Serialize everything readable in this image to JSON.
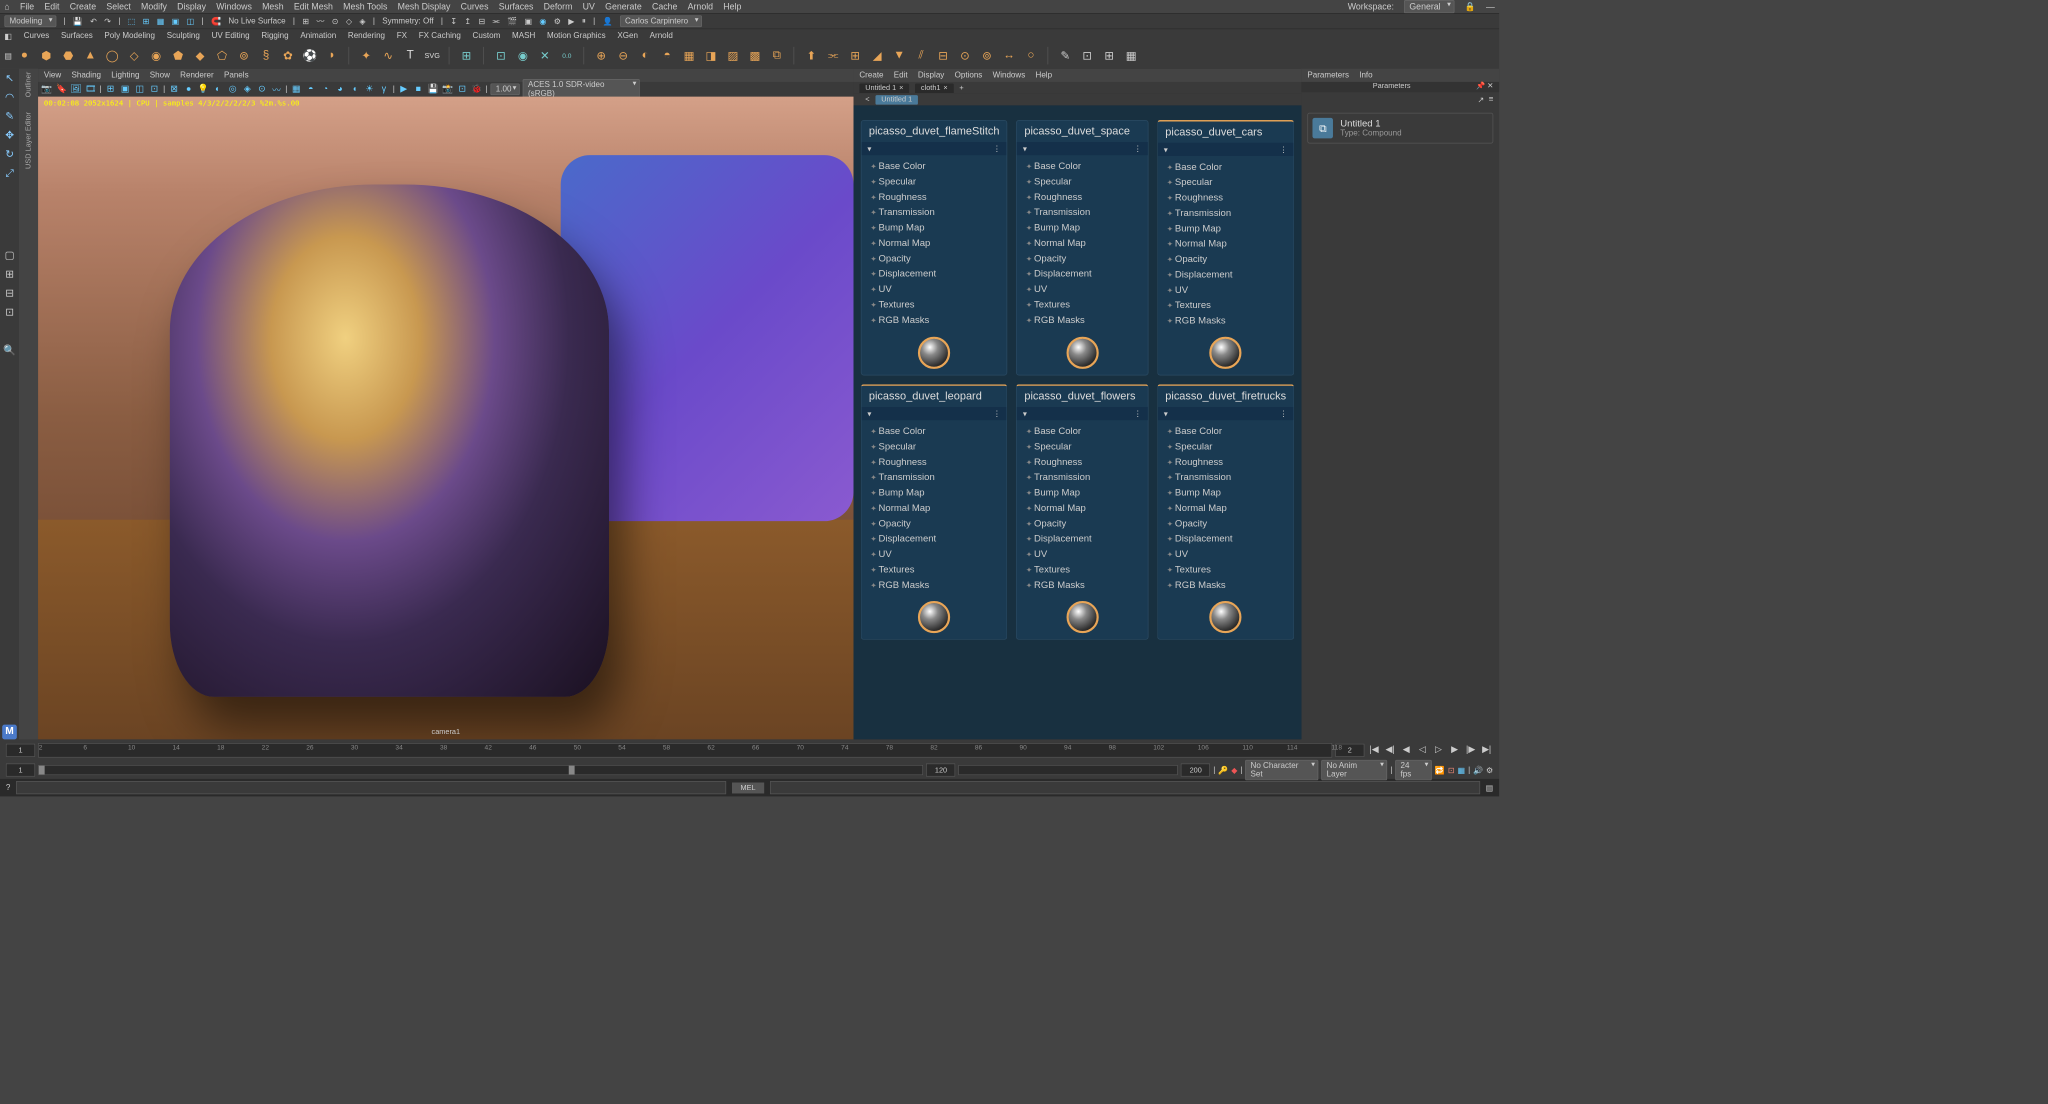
{
  "topmenu": [
    "File",
    "Edit",
    "Create",
    "Select",
    "Modify",
    "Display",
    "Windows",
    "Mesh",
    "Edit Mesh",
    "Mesh Tools",
    "Mesh Display",
    "Curves",
    "Surfaces",
    "Deform",
    "UV",
    "Generate",
    "Cache",
    "Arnold",
    "Help"
  ],
  "workspace": {
    "label": "Workspace:",
    "value": "General"
  },
  "statusline": {
    "mode": "Modeling",
    "nolive": "No Live Surface",
    "symmetry": "Symmetry: Off",
    "user": "Carlos Carpintero"
  },
  "shelftabs": [
    "Curves",
    "Surfaces",
    "Poly Modeling",
    "Sculpting",
    "UV Editing",
    "Rigging",
    "Animation",
    "Rendering",
    "FX",
    "FX Caching",
    "Custom",
    "MASH",
    "Motion Graphics",
    "XGen",
    "Arnold"
  ],
  "leftpanels": [
    "Outliner",
    "USD Layer Editor"
  ],
  "vpmenu": [
    "View",
    "Shading",
    "Lighting",
    "Show",
    "Renderer",
    "Panels"
  ],
  "vphud": "00:02:08  2052x1624 | CPU | samples 4/3/2/2/2/2/3  %2m.%s.00",
  "vpcam": "camera1",
  "vpfield": {
    "value": "1.00",
    "colorspace": "ACES 1.0 SDR-video (sRGB)"
  },
  "npmenu": [
    "Create",
    "Edit",
    "Display",
    "Options",
    "Windows",
    "Help"
  ],
  "nptabs": [
    {
      "label": "Untitled 1",
      "active": false
    },
    {
      "label": "cloth1",
      "active": false
    }
  ],
  "npsub": "Untitled 1",
  "materials": [
    {
      "name": "picasso_duvet_flameStitch",
      "accent": false
    },
    {
      "name": "picasso_duvet_space",
      "accent": false
    },
    {
      "name": "picasso_duvet_cars",
      "accent": true
    },
    {
      "name": "picasso_duvet_leopard",
      "accent": true
    },
    {
      "name": "picasso_duvet_flowers",
      "accent": true
    },
    {
      "name": "picasso_duvet_firetrucks",
      "accent": true
    }
  ],
  "matprops": [
    "Base Color",
    "Specular",
    "Roughness",
    "Transmission",
    "Bump Map",
    "Normal Map",
    "Opacity",
    "Displacement",
    "UV",
    "Textures",
    "RGB Masks"
  ],
  "rptabs": [
    "Parameters",
    "Info"
  ],
  "rpsub": "Parameters",
  "rpitem": {
    "name": "Untitled 1",
    "type": "Type: Compound"
  },
  "timeline": {
    "start": "1",
    "end": "2",
    "marks": [
      2,
      6,
      10,
      14,
      18,
      22,
      26,
      30,
      34,
      38,
      42,
      46,
      50,
      54,
      58,
      62,
      66,
      70,
      74,
      78,
      82,
      86,
      90,
      94,
      98,
      102,
      106,
      110,
      114,
      118
    ]
  },
  "range": {
    "start": "1",
    "mid": "120",
    "end": "200"
  },
  "playback": {
    "charset": "No Character Set",
    "animlayer": "No Anim Layer",
    "fps": "24 fps"
  },
  "cmd": {
    "lang": "MEL"
  }
}
